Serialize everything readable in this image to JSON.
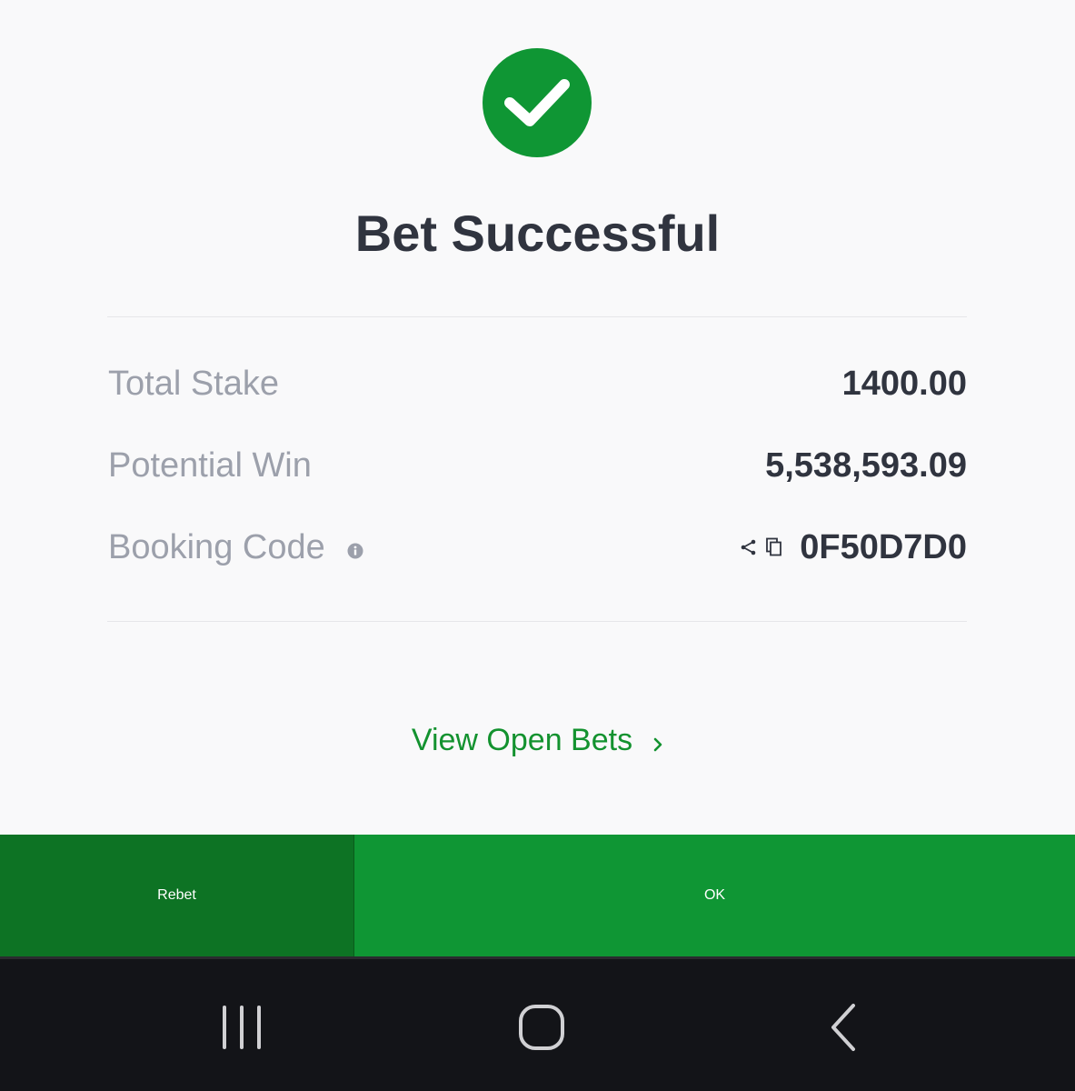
{
  "dialog": {
    "title": "Bet Successful",
    "status_color": "#0f9634",
    "status_icon": "checkmark-icon"
  },
  "summary": {
    "total_stake_label": "Total Stake",
    "total_stake_value": "1400.00",
    "potential_win_label": "Potential Win",
    "potential_win_value": "5,538,593.09",
    "booking_code_label": "Booking Code",
    "booking_code_value": "0F50D7D0"
  },
  "links": {
    "view_open_bets": "View Open Bets"
  },
  "actions": {
    "rebet_label": "Rebet",
    "ok_label": "OK",
    "rebet_color": "#0d7324",
    "ok_color": "#0f9634"
  },
  "system_nav": {
    "recents": "recent-apps-icon",
    "home": "home-icon",
    "back": "back-icon"
  }
}
